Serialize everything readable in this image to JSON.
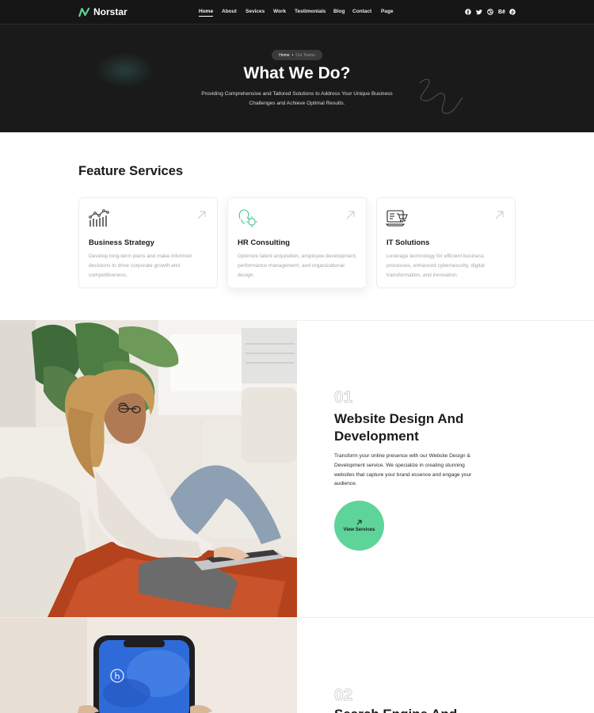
{
  "brand": {
    "name": "Norstar",
    "accent": "#5ed49a"
  },
  "nav": {
    "items": [
      {
        "label": "Home",
        "active": true
      },
      {
        "label": "About",
        "active": false
      },
      {
        "label": "Sevices",
        "active": false
      },
      {
        "label": "Work",
        "active": false
      },
      {
        "label": "Testimonials",
        "active": false
      },
      {
        "label": "Blog",
        "active": false
      },
      {
        "label": "Contact",
        "active": false
      },
      {
        "label": "Page",
        "active": false
      }
    ],
    "socials": [
      {
        "icon": "facebook-icon",
        "glyph": "f"
      },
      {
        "icon": "twitter-icon",
        "glyph": "t"
      },
      {
        "icon": "dribbble-icon",
        "glyph": "d"
      },
      {
        "icon": "behance-icon",
        "glyph": "Bē"
      },
      {
        "icon": "pinterest-icon",
        "glyph": "p"
      }
    ]
  },
  "hero": {
    "breadcrumb": {
      "home": "Home",
      "separator": "•",
      "current": "Our Teams"
    },
    "title": "What We Do?",
    "subtitle": "Providing Comprehensive and Tailored Solutions to Address Your Unique Business Challenges and Achieve Optimal Results."
  },
  "features": {
    "title": "Feature Services",
    "cards": [
      {
        "icon": "chart-icon",
        "title": "Business Strategy",
        "text": "Develop long-term plans and make informed decisions to drive corporate growth and competitiveness."
      },
      {
        "icon": "hr-person-icon",
        "title": "HR Consulting",
        "text": "Optimize talent acquisition, employee development, performance management, and organizational design."
      },
      {
        "icon": "it-cart-icon",
        "title": "IT Solutions",
        "text": "Leverage technology for efficient business processes, enhanced cybersecurity, digital transformation, and innovation."
      }
    ]
  },
  "services": [
    {
      "number": "01",
      "title": "Website Design And Development",
      "text": "Transform your online presence with our Website Design & Development service. We specialize in creating stunning websites that capture your brand essence and engage your audience.",
      "button": "View Services"
    },
    {
      "number": "02",
      "title": "Search Engine And"
    }
  ]
}
